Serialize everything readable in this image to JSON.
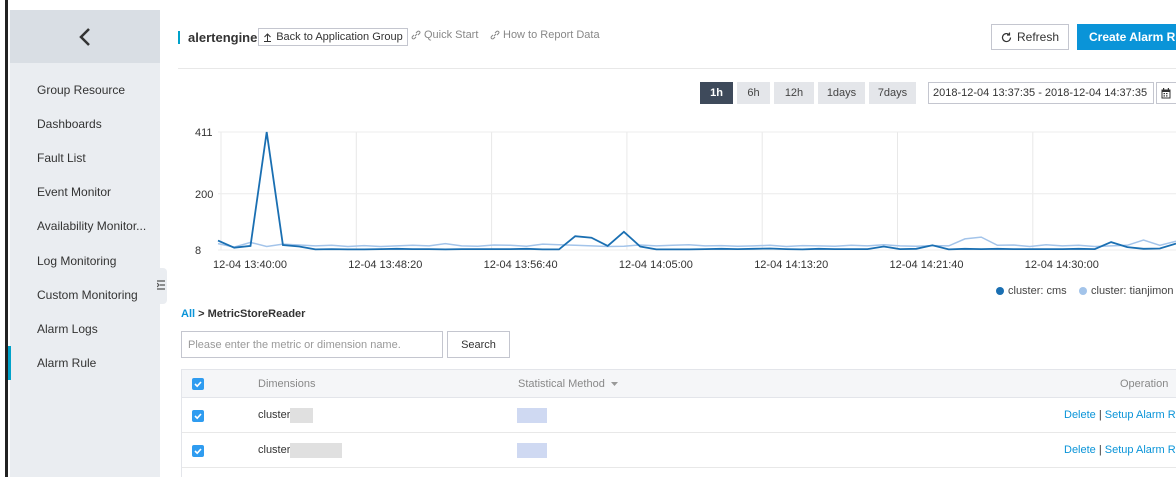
{
  "sidebar": {
    "items": [
      {
        "label": "Group Resource"
      },
      {
        "label": "Dashboards"
      },
      {
        "label": "Fault List"
      },
      {
        "label": "Event Monitor"
      },
      {
        "label": "Availability Monitor..."
      },
      {
        "label": "Log Monitoring"
      },
      {
        "label": "Custom Monitoring"
      },
      {
        "label": "Alarm Logs"
      },
      {
        "label": "Alarm Rule",
        "active": true
      }
    ]
  },
  "header": {
    "app_name": "alertengine",
    "back_label": "Back to Application Group",
    "quick_start": "Quick Start",
    "how_to_report": "How to Report Data",
    "refresh_label": "Refresh",
    "create_label": "Create Alarm Rule"
  },
  "time_range": {
    "options": [
      "1h",
      "6h",
      "12h",
      "1days",
      "7days"
    ],
    "selected": "1h",
    "date_range": "2018-12-04 13:37:35 - 2018-12-04 14:37:35"
  },
  "chart_data": {
    "type": "line",
    "y_ticks": [
      "411",
      "200",
      "8"
    ],
    "ylim": [
      8,
      411
    ],
    "x_ticks": [
      "12-04 13:40:00",
      "12-04 13:48:20",
      "12-04 13:56:40",
      "12-04 14:05:00",
      "12-04 14:13:20",
      "12-04 14:21:40",
      "12-04 14:30:00"
    ],
    "series": [
      {
        "name": "cluster: cms",
        "color": "#1a6fb2",
        "values": [
          40,
          16,
          22,
          411,
          25,
          20,
          10,
          11,
          10,
          10,
          11,
          12,
          11,
          11,
          10,
          11,
          11,
          11,
          11,
          12,
          10,
          10,
          55,
          50,
          22,
          70,
          20,
          10,
          10,
          10,
          11,
          12,
          11,
          12,
          13,
          11,
          10,
          12,
          11,
          11,
          11,
          20,
          11,
          12,
          24,
          10,
          12,
          11,
          12,
          11,
          11,
          11,
          11,
          12,
          11,
          35,
          18,
          12,
          13,
          30
        ]
      },
      {
        "name": "cluster: tianjimon",
        "color": "#a3c4ea",
        "values": [
          30,
          18,
          34,
          20,
          28,
          25,
          22,
          24,
          20,
          23,
          20,
          22,
          24,
          22,
          30,
          22,
          21,
          25,
          24,
          21,
          28,
          26,
          24,
          22,
          20,
          21,
          25,
          22,
          24,
          26,
          22,
          23,
          21,
          22,
          24,
          20,
          23,
          22,
          21,
          24,
          22,
          26,
          22,
          21,
          23,
          22,
          46,
          52,
          24,
          25,
          20,
          26,
          22,
          24,
          20,
          22,
          24,
          42,
          24,
          38
        ]
      }
    ]
  },
  "breadcrumb": {
    "all": "All",
    "sep": ">",
    "current": "MetricStoreReader"
  },
  "search": {
    "placeholder": "Please enter the metric or dimension name.",
    "button": "Search"
  },
  "table": {
    "headers": {
      "dimensions": "Dimensions",
      "method": "Statistical Method",
      "operation": "Operation"
    },
    "rows": [
      {
        "dimension": "cluster:",
        "delete": "Delete",
        "sep": "|",
        "setup": "Setup Alarm Rule"
      },
      {
        "dimension": "cluster:",
        "delete": "Delete",
        "sep": "|",
        "setup": "Setup Alarm Rule"
      }
    ]
  },
  "colors": {
    "accent": "#0a94d8",
    "sidebar_bg": "#eaedf1",
    "active_time": "#3e4a5b"
  }
}
